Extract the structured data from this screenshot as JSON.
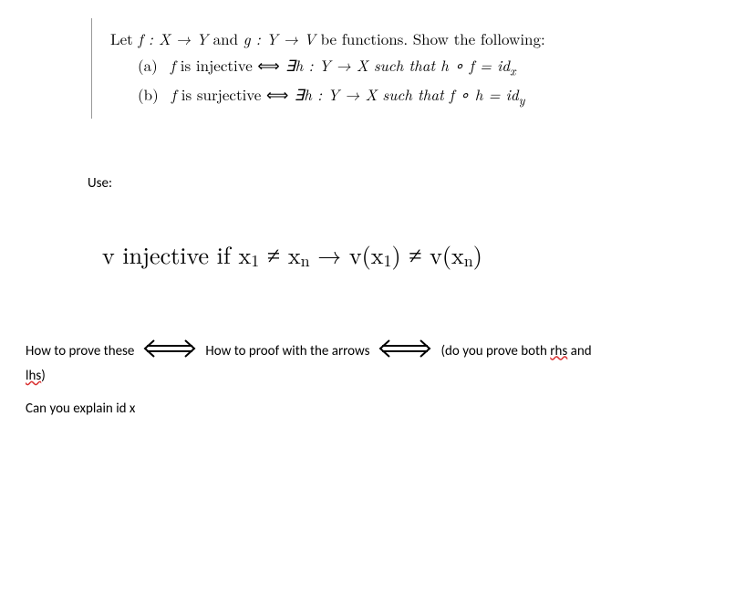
{
  "problem": {
    "intro_prefix": "Let ",
    "f_decl": "f : X → Y",
    "and_word": " and ",
    "g_decl": "g : Y → V",
    "intro_suffix": " be functions. Show the following:",
    "item_a_label": "(a)",
    "item_a_prefix": "f",
    "item_a_text1": " is injective ",
    "item_a_iff": "⟺",
    "item_a_text2": " ∃h : Y → X such that ",
    "item_a_comp": "h ∘ f = id",
    "item_a_sub": "x",
    "item_b_label": "(b)",
    "item_b_prefix": "f",
    "item_b_text1": " is surjective ",
    "item_b_iff": "⟺",
    "item_b_text2": " ∃h : Y → X such that ",
    "item_b_comp": "f ∘ h = id",
    "item_b_sub": "y"
  },
  "use_label": "Use:",
  "inj_def": {
    "p1": "v injective if x",
    "s1": "1",
    "p2": "  ≠ x",
    "s2": "n",
    "p3": " →   v(x",
    "s3": "1",
    "p4": ")  ≠ v(x",
    "s4": "n",
    "p5": ")"
  },
  "questions": {
    "q1a": "How to prove these",
    "q1b": "How to proof with the arrows",
    "q1c_prefix": "(do you prove both ",
    "q1c_rhs": "rhs",
    "q1c_and": " and ",
    "q1c_lhs": "lhs",
    "q1c_suffix": ")",
    "q2": "Can you explain id x"
  }
}
